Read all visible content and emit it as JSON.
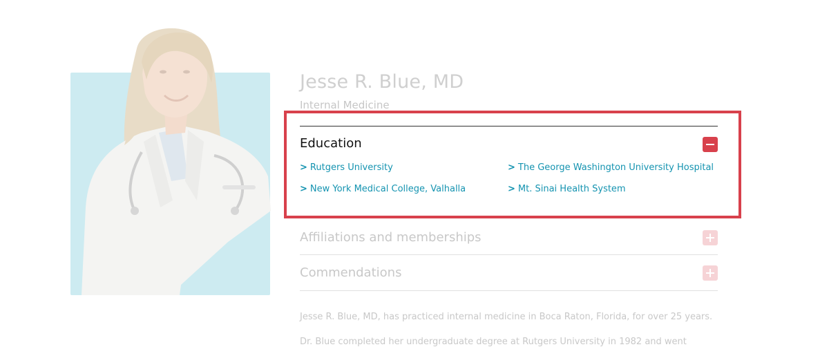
{
  "doctor": {
    "name": "Jesse R. Blue, MD",
    "specialty": "Internal Medicine"
  },
  "education": {
    "title": "Education",
    "links": [
      "Rutgers University",
      "The George Washington University Hospital",
      "New York Medical College, Valhalla",
      "Mt. Sinai Health System"
    ]
  },
  "sections": {
    "affiliations": "Affiliations and memberships",
    "commendations": "Commendations"
  },
  "bio": {
    "p1": "Jesse R. Blue, MD, has practiced internal medicine in Boca Raton, Florida, for over 25 years.",
    "p2": "Dr. Blue completed her undergraduate degree at Rutgers University in 1982 and went"
  },
  "colors": {
    "accent": "#d8414c",
    "link": "#1493b0",
    "photo_bg": "#cdebf1"
  },
  "icons": {
    "collapse": "minus-icon",
    "expand": "plus-icon",
    "link_marker": "chevron-right-icon"
  }
}
